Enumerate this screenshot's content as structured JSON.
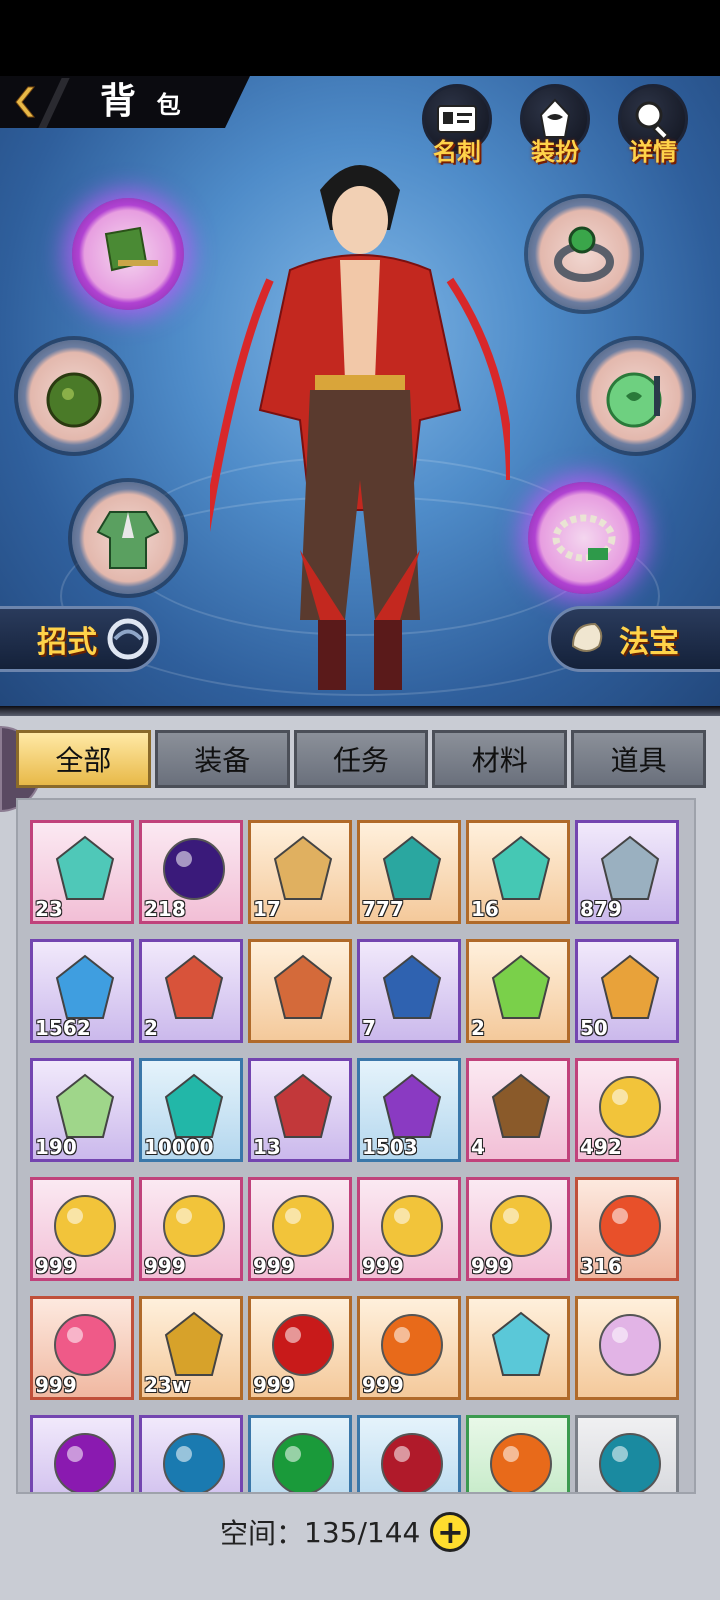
{
  "header": {
    "title_big": "背",
    "title_small": "包"
  },
  "top_buttons": [
    {
      "label": "名刺",
      "icon": "card-icon"
    },
    {
      "label": "装扮",
      "icon": "costume-icon"
    },
    {
      "label": "详情",
      "icon": "magnifier-icon"
    }
  ],
  "equipment_slots": [
    "hat",
    "ring",
    "pouch",
    "jade-pendant",
    "robe",
    "bracelet"
  ],
  "side_buttons": {
    "left": "招式",
    "right": "法宝"
  },
  "tabs": [
    "全部",
    "装备",
    "任务",
    "材料",
    "道具"
  ],
  "active_tab": 0,
  "items": [
    {
      "rarity": "pink",
      "count": "23",
      "icon": "scroll-card-icon"
    },
    {
      "rarity": "pink",
      "count": "218",
      "icon": "dark-orb-icon"
    },
    {
      "rarity": "orange",
      "count": "17",
      "icon": "crystal-crown-icon"
    },
    {
      "rarity": "orange",
      "count": "777",
      "icon": "teal-bottle-icon"
    },
    {
      "rarity": "orange",
      "count": "16",
      "icon": "jade-toad-icon"
    },
    {
      "rarity": "purple",
      "count": "879",
      "icon": "porcelain-vase-icon"
    },
    {
      "rarity": "purple",
      "count": "1562",
      "icon": "blue-crystal-icon"
    },
    {
      "rarity": "purple",
      "count": "2",
      "icon": "maple-leaf-icon"
    },
    {
      "rarity": "orange",
      "count": "",
      "icon": "lion-portrait-icon"
    },
    {
      "rarity": "purple",
      "count": "7",
      "icon": "blue-powder-icon"
    },
    {
      "rarity": "orange",
      "count": "2",
      "icon": "green-potion-icon"
    },
    {
      "rarity": "purple",
      "count": "50",
      "icon": "golden-dragon-icon"
    },
    {
      "rarity": "purple",
      "count": "190",
      "icon": "green-talisman-icon"
    },
    {
      "rarity": "blue",
      "count": "10000",
      "icon": "teal-gem-icon"
    },
    {
      "rarity": "purple",
      "count": "13",
      "icon": "red-tag-icon"
    },
    {
      "rarity": "blue",
      "count": "1503",
      "icon": "purple-tag-icon"
    },
    {
      "rarity": "pink",
      "count": "4",
      "icon": "treasure-chest-icon"
    },
    {
      "rarity": "pink",
      "count": "492",
      "icon": "golden-lotus-orb-icon"
    },
    {
      "rarity": "pink",
      "count": "999",
      "icon": "golden-lotus-orb-icon"
    },
    {
      "rarity": "pink",
      "count": "999",
      "icon": "golden-lotus-orb-icon"
    },
    {
      "rarity": "pink",
      "count": "999",
      "icon": "golden-lotus-orb-icon"
    },
    {
      "rarity": "pink",
      "count": "999",
      "icon": "golden-lotus-orb-icon"
    },
    {
      "rarity": "pink",
      "count": "999",
      "icon": "golden-lotus-orb-icon"
    },
    {
      "rarity": "red",
      "count": "316",
      "icon": "red-lotus-orb-icon"
    },
    {
      "rarity": "red",
      "count": "999",
      "icon": "pink-lotus-orb-icon"
    },
    {
      "rarity": "orange",
      "count": "23w",
      "icon": "gold-nugget-icon"
    },
    {
      "rarity": "orange",
      "count": "999",
      "icon": "red-orb-icon"
    },
    {
      "rarity": "orange",
      "count": "999",
      "icon": "orange-orb-icon"
    },
    {
      "rarity": "orange",
      "count": "",
      "icon": "rename-card-icon"
    },
    {
      "rarity": "orange",
      "count": "",
      "icon": "pearl-orb-icon"
    },
    {
      "rarity": "purple",
      "count": "",
      "icon": "purple-orb-icon"
    },
    {
      "rarity": "purple",
      "count": "",
      "icon": "blue-orb-icon"
    },
    {
      "rarity": "blue",
      "count": "",
      "icon": "green-orb-icon"
    },
    {
      "rarity": "blue",
      "count": "",
      "icon": "crimson-orb-icon"
    },
    {
      "rarity": "green",
      "count": "",
      "icon": "orange-orb-icon"
    },
    {
      "rarity": "gray",
      "count": "",
      "icon": "teal-orb-icon"
    }
  ],
  "item_colors": {
    "scroll-card-icon": "#4fc8b8",
    "dark-orb-icon": "#3a1a7a",
    "crystal-crown-icon": "#e0b060",
    "teal-bottle-icon": "#2aa7a0",
    "jade-toad-icon": "#45c8b4",
    "porcelain-vase-icon": "#9ab0c0",
    "blue-crystal-icon": "#3f9ee0",
    "maple-leaf-icon": "#d8533a",
    "lion-portrait-icon": "#d46a3a",
    "blue-powder-icon": "#2f62b0",
    "green-potion-icon": "#7ad04a",
    "golden-dragon-icon": "#e8a23a",
    "green-talisman-icon": "#9fd68a",
    "teal-gem-icon": "#22b7a8",
    "red-tag-icon": "#c2383a",
    "purple-tag-icon": "#8a3ac2",
    "treasure-chest-icon": "#8a5a2a",
    "golden-lotus-orb-icon": "#f2c43a",
    "red-lotus-orb-icon": "#e8502a",
    "pink-lotus-orb-icon": "#ef5a88",
    "gold-nugget-icon": "#d7a22a",
    "red-orb-icon": "#c81a1a",
    "orange-orb-icon": "#e86a1a",
    "rename-card-icon": "#5ac8d8",
    "pearl-orb-icon": "#e2b4e6",
    "purple-orb-icon": "#8a1ab0",
    "blue-orb-icon": "#1a7ab0",
    "green-orb-icon": "#1a9a3a",
    "crimson-orb-icon": "#b01a2a",
    "teal-orb-icon": "#1a8aa0"
  },
  "space": {
    "label": "空间：",
    "value": "135/144",
    "plus": "+"
  }
}
